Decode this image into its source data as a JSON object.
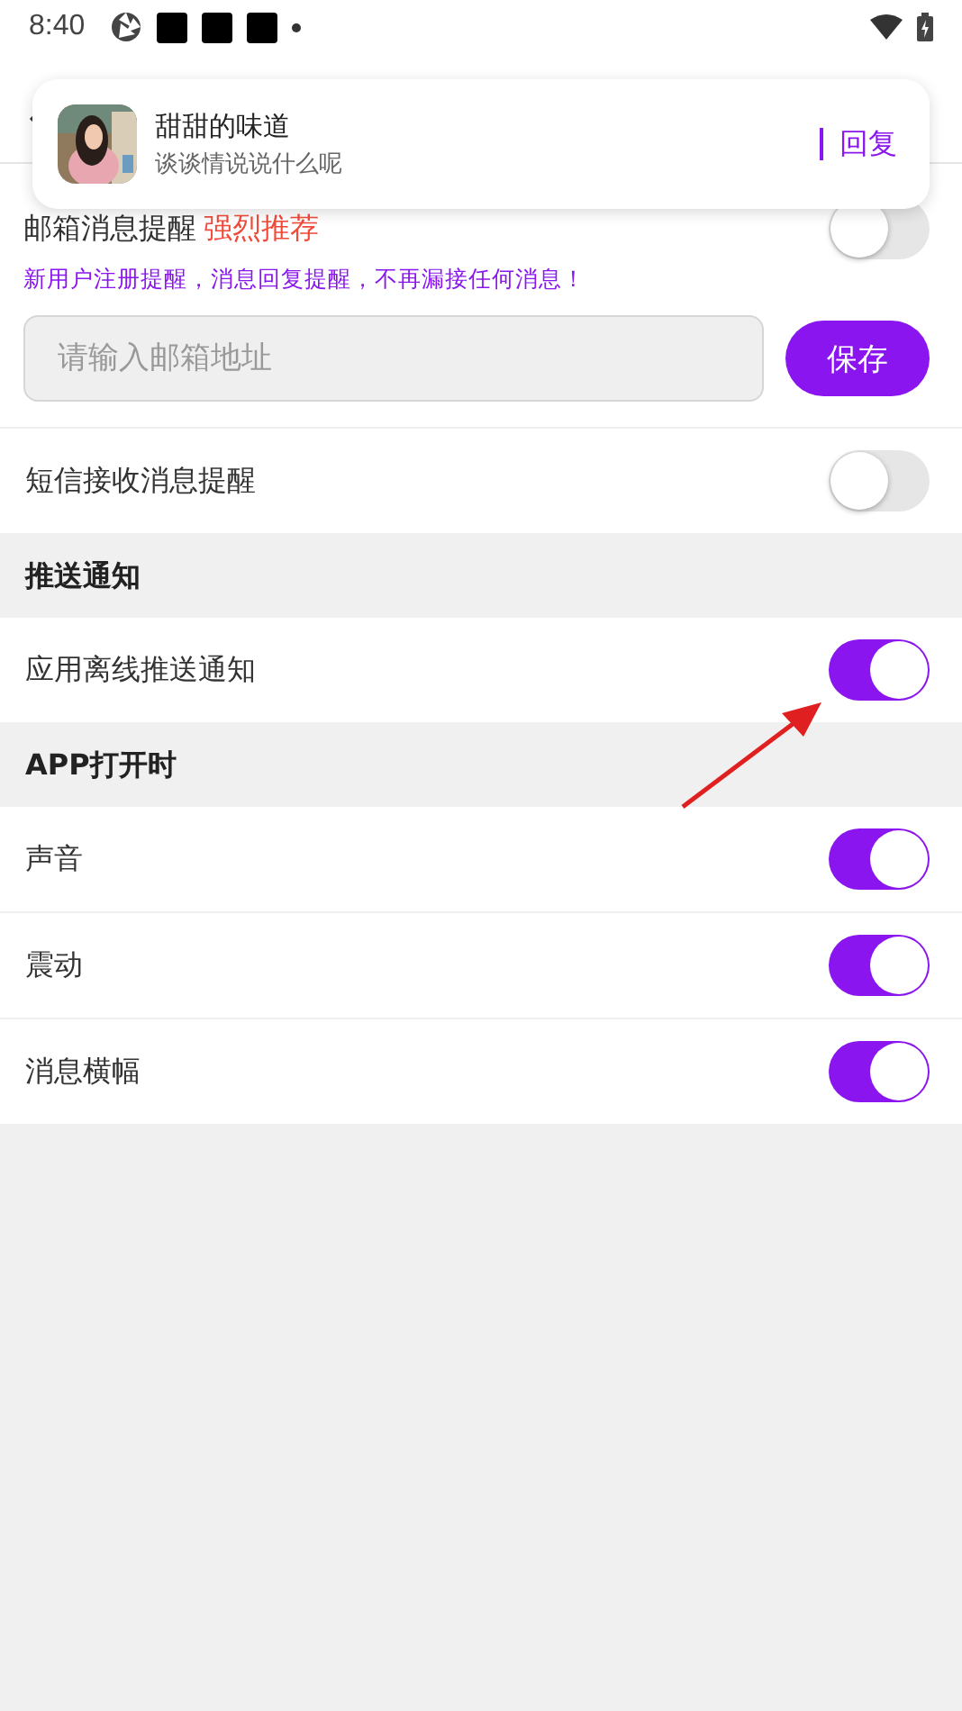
{
  "status_bar": {
    "time": "8:40"
  },
  "notification": {
    "title": "甜甜的味道",
    "message": "谈谈情说说什么呢",
    "action": "回复"
  },
  "email": {
    "label": "邮箱消息提醒",
    "badge": "强烈推荐",
    "on": false,
    "hint": "新用户注册提醒，消息回复提醒，不再漏接任何消息！",
    "placeholder": "请输入邮箱地址",
    "save": "保存"
  },
  "rows": [
    {
      "kind": "toggle",
      "label": "短信接收消息提醒",
      "on": false
    },
    {
      "kind": "section",
      "label": "推送通知"
    },
    {
      "kind": "toggle",
      "label": "应用离线推送通知",
      "on": true
    },
    {
      "kind": "section",
      "label": "APP打开时"
    },
    {
      "kind": "toggle",
      "label": "声音",
      "on": true
    },
    {
      "kind": "toggle",
      "label": "震动",
      "on": true
    },
    {
      "kind": "toggle",
      "label": "消息横幅",
      "on": true
    }
  ]
}
